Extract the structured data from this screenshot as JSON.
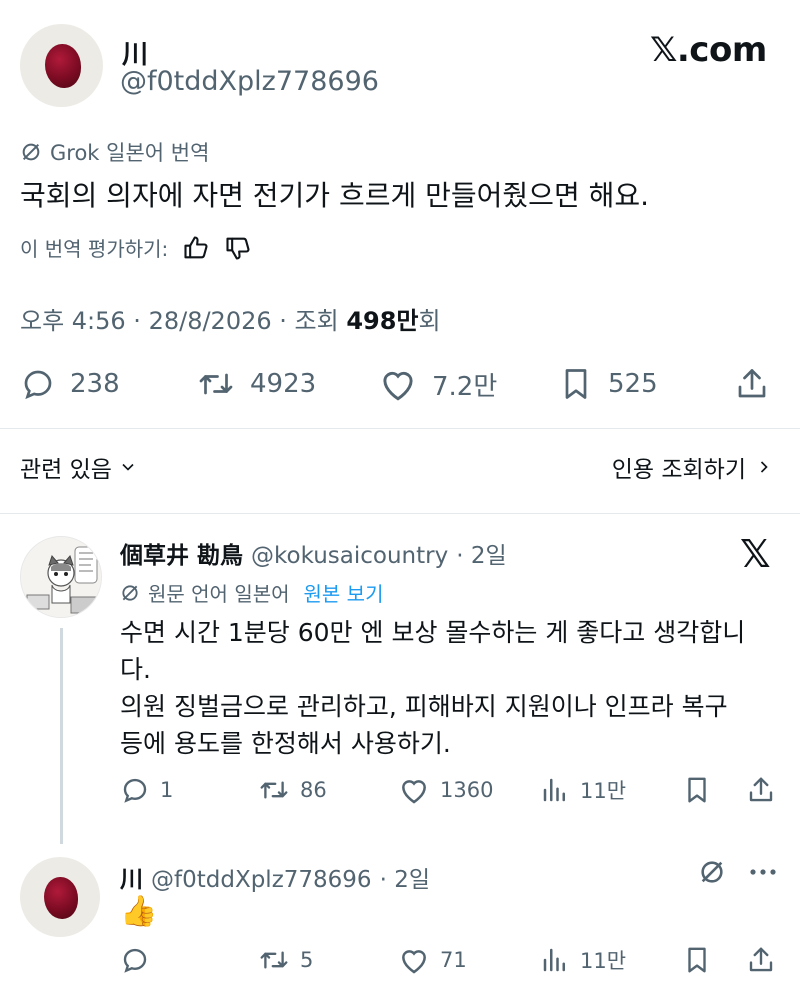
{
  "main_tweet": {
    "author_name": "川",
    "author_handle": "@f0tddXplz778696",
    "site_logo": "𝕏.com",
    "translation_label": "Grok 일본어 번역",
    "text": "국회의 의자에 자면 전기가 흐르게 만들어줬으면 해요.",
    "rate_label": "이 번역 평가하기:",
    "meta_time_date": "오후 4:56 · 28/8/2026 · 조회",
    "meta_views_number": "498만",
    "meta_views_suffix": "회",
    "actions": {
      "replies": "238",
      "retweets": "4923",
      "likes": "7.2만",
      "bookmarks": "525"
    }
  },
  "related": {
    "left_label": "관련 있음",
    "right_label": "인용 조회하기"
  },
  "reply1": {
    "author_name": "個草井 勘鳥",
    "author_handle": "@kokusaicountry",
    "time": "· 2일",
    "lang_label": "원문 언어 일본어",
    "view_original": "원본 보기",
    "lines": [
      "수면 시간 1분당 60만 엔 보상 몰수하는 게 좋다고 생각합니",
      "다.",
      "의원 징벌금으로 관리하고, 피해바지 지원이나 인프라 복구",
      "등에 용도를 한정해서 사용하기."
    ],
    "actions": {
      "replies": "1",
      "retweets": "86",
      "likes": "1360",
      "views": "11만"
    }
  },
  "reply2": {
    "author_name": "川",
    "author_handle": "@f0tddXplz778696",
    "time": "· 2일",
    "text": "👍",
    "actions": {
      "retweets": "5",
      "likes": "71",
      "views": "11만"
    }
  },
  "colors": {
    "text": "#0f1419",
    "muted": "#536471",
    "accent": "#1d9bf0",
    "divider": "#e6e9ec"
  }
}
